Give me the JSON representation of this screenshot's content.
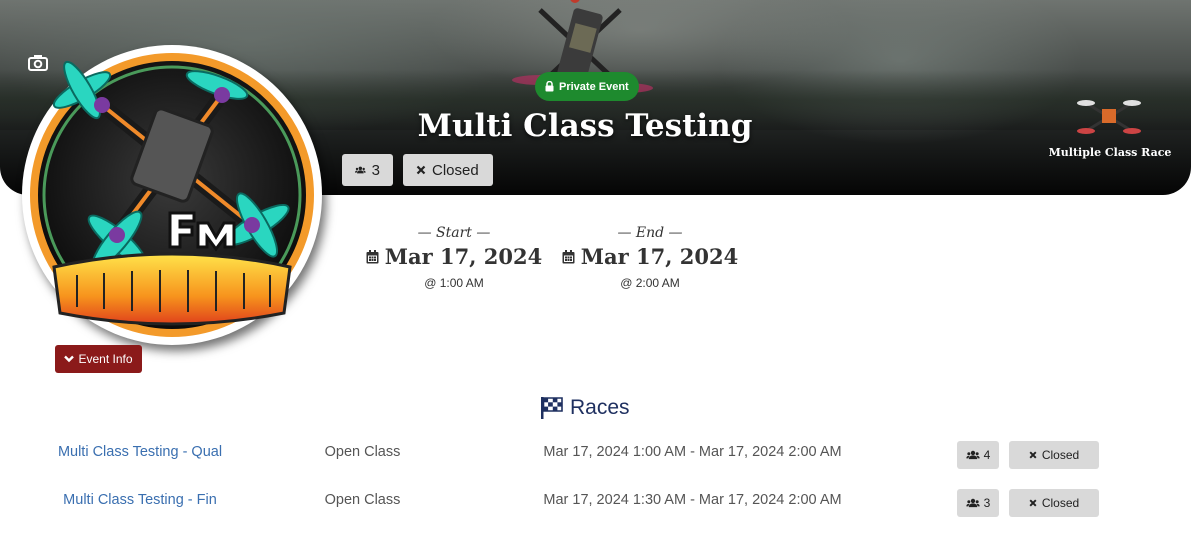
{
  "header": {
    "privacy_badge": "Private Event",
    "title": "Multi Class Testing",
    "participants_count": "3",
    "status_label": "Closed",
    "class_label": "Multiple Class Race"
  },
  "schedule": {
    "start_caption": "— Start —",
    "start_date": "Mar 17, 2024",
    "start_time": "@ 1:00 AM",
    "end_caption": "— End —",
    "end_date": "Mar 17, 2024",
    "end_time": "@ 2:00 AM"
  },
  "event_info_button": "Event Info",
  "races": {
    "heading": "Races",
    "rows": [
      {
        "name": "Multi Class Testing - Qual",
        "class": "Open Class",
        "time": "Mar 17, 2024 1:00 AM - Mar 17, 2024 2:00 AM",
        "count": "4",
        "status": "Closed"
      },
      {
        "name": "Multi Class Testing - Fin",
        "class": "Open Class",
        "time": "Mar 17, 2024 1:30 AM - Mar 17, 2024 2:00 AM",
        "count": "3",
        "status": "Closed"
      }
    ]
  },
  "colors": {
    "private_badge": "#1e8a2e",
    "event_info_button": "#8b1a1a",
    "race_link": "#3a6fb0",
    "races_heading": "#1f3060"
  },
  "icons": [
    "camera-icon",
    "lock-icon",
    "users-icon",
    "close-icon",
    "calendar-icon",
    "chevron-down-icon",
    "checkered-flag-icon"
  ]
}
